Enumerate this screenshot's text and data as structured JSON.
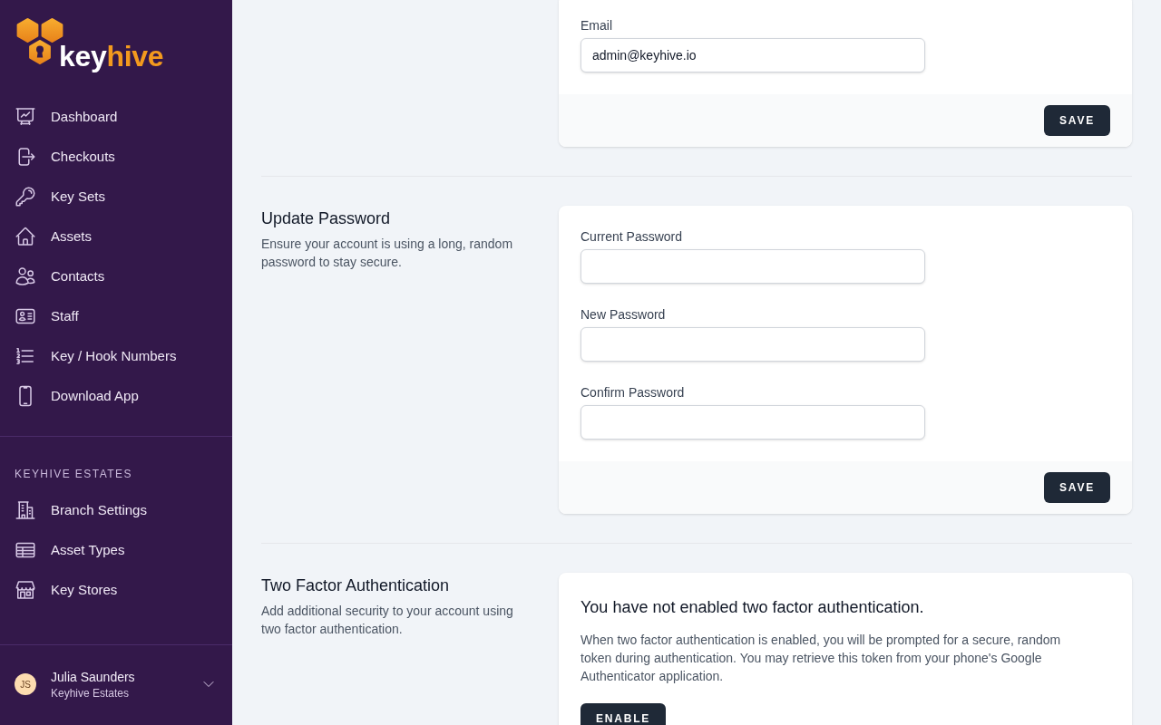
{
  "sidebar": {
    "brand": {
      "first_part": "key",
      "second_part": "hive"
    },
    "nav_items": [
      {
        "label": "Dashboard",
        "selected": false
      },
      {
        "label": "Checkouts",
        "selected": false
      },
      {
        "label": "Key Sets",
        "selected": false
      },
      {
        "label": "Assets",
        "selected": false
      },
      {
        "label": "Contacts",
        "selected": false
      },
      {
        "label": "Staff",
        "selected": false
      },
      {
        "label": "Key / Hook Numbers",
        "selected": false
      },
      {
        "label": "Download App",
        "selected": false
      }
    ],
    "section_title": "KEYHIVE ESTATES",
    "section_items": [
      {
        "label": "Branch Settings",
        "selected": false
      },
      {
        "label": "Asset Types",
        "selected": false
      },
      {
        "label": "Key Stores",
        "selected": false
      }
    ],
    "user": {
      "initials": "JS",
      "name": "Julia Saunders",
      "organization": "Keyhive Estates"
    }
  },
  "main": {
    "sections": [
      {
        "kind": "form",
        "fields": [
          {
            "label": "Email",
            "value": "admin@keyhive.io"
          }
        ],
        "button": "SAVE"
      },
      {
        "kind": "form",
        "title": "Update Password",
        "description": "Ensure your account is using a long, random password to stay secure.",
        "fields": [
          {
            "label": "Current Password"
          },
          {
            "label": "New Password"
          },
          {
            "label": "Confirm Password"
          }
        ],
        "button": "SAVE"
      },
      {
        "kind": "message",
        "title": "Two Factor Authentication",
        "description": "Add additional security to your account using two factor authentication.",
        "heading": "You have not enabled two factor authentication.",
        "text": "When two factor authentication is enabled, you will be prompted for a secure, random token during authentication. You may retrieve this token from your phone's Google Authenticator application.",
        "button": "ENABLE"
      }
    ]
  }
}
